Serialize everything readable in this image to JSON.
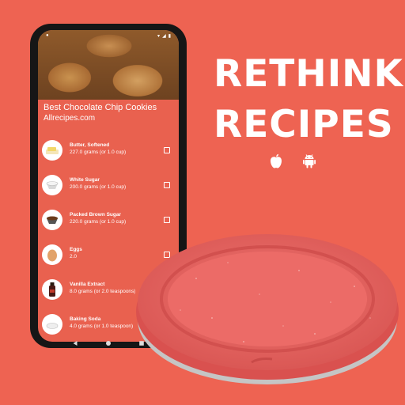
{
  "tagline": {
    "line1": "RETHINK",
    "line2": "RECIPES"
  },
  "platforms": [
    "apple-icon",
    "android-icon"
  ],
  "app": {
    "recipe_title": "Best Chocolate Chip Cookies",
    "recipe_source": "Allrecipes.com",
    "ingredients": [
      {
        "name": "Butter, Softened",
        "quantity": "227.0 grams (or 1.0 cup)",
        "icon": "butter-icon"
      },
      {
        "name": "White Sugar",
        "quantity": "200.0 grams (or 1.0 cup)",
        "icon": "white-sugar-icon"
      },
      {
        "name": "Packed Brown Sugar",
        "quantity": "220.0 grams (or 1.0 cup)",
        "icon": "brown-sugar-icon"
      },
      {
        "name": "Eggs",
        "quantity": "2.0",
        "icon": "egg-icon"
      },
      {
        "name": "Vanilla Extract",
        "quantity": "8.0 grams (or 2.0 teaspoons)",
        "icon": "vanilla-icon"
      },
      {
        "name": "Baking Soda",
        "quantity": "4.0 grams (or 1.0 teaspoon)",
        "icon": "baking-soda-icon"
      }
    ]
  },
  "colors": {
    "background": "#ee6352",
    "app_background": "#e9614f",
    "lid": "#e8605a",
    "text": "#ffffff"
  }
}
